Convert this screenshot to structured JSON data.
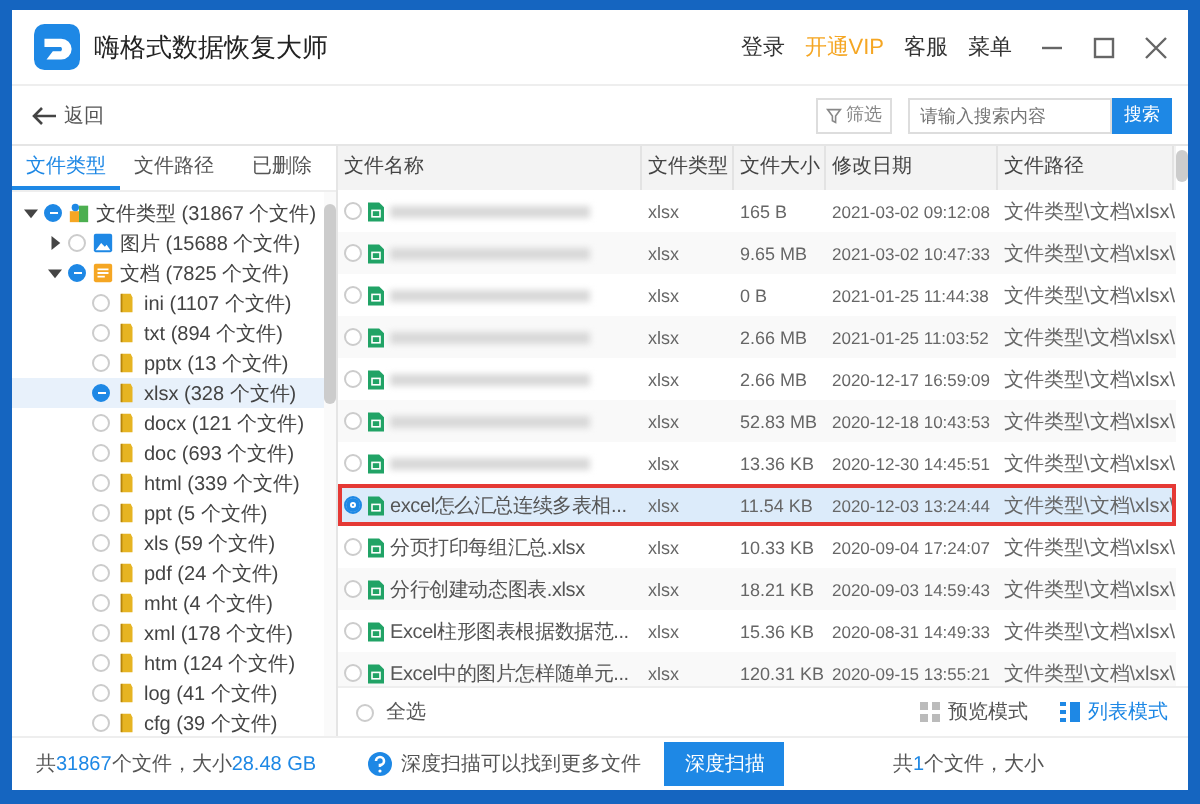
{
  "window": {
    "title": "嗨格式数据恢复大师",
    "actions": [
      {
        "label": "登录",
        "vip": false
      },
      {
        "label": "开通VIP",
        "vip": true
      },
      {
        "label": "客服",
        "vip": false
      },
      {
        "label": "菜单",
        "vip": false
      }
    ]
  },
  "toolbar": {
    "back": "返回",
    "filter": "筛选",
    "search": {
      "placeholder": "请输入搜索内容",
      "button": "搜索"
    }
  },
  "sidebar": {
    "tabs": [
      {
        "label": "文件类型",
        "selected": true
      },
      {
        "label": "文件路径",
        "selected": false
      },
      {
        "label": "已删除",
        "selected": false
      }
    ],
    "tree": [
      {
        "label": "文件类型 (31867 个文件)",
        "partial": true,
        "expanded": true,
        "kind": "root",
        "selected": false,
        "children": [
          {
            "label": "图片 (15688 个文件)",
            "partial": false,
            "expanded": false,
            "kind": "image",
            "selected": false
          },
          {
            "label": "文档 (7825 个文件)",
            "partial": true,
            "expanded": true,
            "kind": "docs",
            "selected": false,
            "children": [
              {
                "label": "ini (1107 个文件)",
                "partial": false,
                "kind": "folder",
                "selected": false
              },
              {
                "label": "txt (894 个文件)",
                "partial": false,
                "kind": "folder",
                "selected": false
              },
              {
                "label": "pptx (13 个文件)",
                "partial": false,
                "kind": "folder",
                "selected": false
              },
              {
                "label": "xlsx (328 个文件)",
                "partial": true,
                "kind": "folder",
                "selected": true
              },
              {
                "label": "docx (121 个文件)",
                "partial": false,
                "kind": "folder",
                "selected": false
              },
              {
                "label": "doc (693 个文件)",
                "partial": false,
                "kind": "folder",
                "selected": false
              },
              {
                "label": "html (339 个文件)",
                "partial": false,
                "kind": "folder",
                "selected": false
              },
              {
                "label": "ppt (5 个文件)",
                "partial": false,
                "kind": "folder",
                "selected": false
              },
              {
                "label": "xls (59 个文件)",
                "partial": false,
                "kind": "folder",
                "selected": false
              },
              {
                "label": "pdf (24 个文件)",
                "partial": false,
                "kind": "folder",
                "selected": false
              },
              {
                "label": "mht (4 个文件)",
                "partial": false,
                "kind": "folder",
                "selected": false
              },
              {
                "label": "xml (178 个文件)",
                "partial": false,
                "kind": "folder",
                "selected": false
              },
              {
                "label": "htm (124 个文件)",
                "partial": false,
                "kind": "folder",
                "selected": false
              },
              {
                "label": "log (41 个文件)",
                "partial": false,
                "kind": "folder",
                "selected": false
              },
              {
                "label": "cfg (39 个文件)",
                "partial": false,
                "kind": "folder",
                "selected": false
              }
            ]
          }
        ]
      }
    ]
  },
  "table": {
    "columns": [
      "文件名称",
      "文件类型",
      "文件大小",
      "修改日期",
      "文件路径"
    ],
    "rows": [
      {
        "name": null,
        "type": "xlsx",
        "size": "165 B",
        "date": "2021-03-02 09:12:08",
        "path": "文件类型\\文档\\xlsx\\",
        "selected": false,
        "marked": false
      },
      {
        "name": null,
        "type": "xlsx",
        "size": "9.65 MB",
        "date": "2021-03-02 10:47:33",
        "path": "文件类型\\文档\\xlsx\\",
        "selected": false,
        "marked": false
      },
      {
        "name": null,
        "type": "xlsx",
        "size": "0 B",
        "date": "2021-01-25 11:44:38",
        "path": "文件类型\\文档\\xlsx\\",
        "selected": false,
        "marked": false
      },
      {
        "name": null,
        "type": "xlsx",
        "size": "2.66 MB",
        "date": "2021-01-25 11:03:52",
        "path": "文件类型\\文档\\xlsx\\",
        "selected": false,
        "marked": false
      },
      {
        "name": null,
        "type": "xlsx",
        "size": "2.66 MB",
        "date": "2020-12-17 16:59:09",
        "path": "文件类型\\文档\\xlsx\\",
        "selected": false,
        "marked": false
      },
      {
        "name": null,
        "type": "xlsx",
        "size": "52.83 MB",
        "date": "2020-12-18 10:43:53",
        "path": "文件类型\\文档\\xlsx\\",
        "selected": false,
        "marked": false
      },
      {
        "name": null,
        "type": "xlsx",
        "size": "13.36 KB",
        "date": "2020-12-30 14:45:51",
        "path": "文件类型\\文档\\xlsx\\",
        "selected": false,
        "marked": false
      },
      {
        "name": "excel怎么汇总连续多表相...",
        "type": "xlsx",
        "size": "11.54 KB",
        "date": "2020-12-03 13:24:44",
        "path": "文件类型\\文档\\xlsx\\",
        "selected": true,
        "marked": true
      },
      {
        "name": "分页打印每组汇总.xlsx",
        "type": "xlsx",
        "size": "10.33 KB",
        "date": "2020-09-04 17:24:07",
        "path": "文件类型\\文档\\xlsx\\",
        "selected": false,
        "marked": false
      },
      {
        "name": "分行创建动态图表.xlsx",
        "type": "xlsx",
        "size": "18.21 KB",
        "date": "2020-09-03 14:59:43",
        "path": "文件类型\\文档\\xlsx\\",
        "selected": false,
        "marked": false
      },
      {
        "name": "Excel柱形图表根据数据范...",
        "type": "xlsx",
        "size": "15.36 KB",
        "date": "2020-08-31 14:49:33",
        "path": "文件类型\\文档\\xlsx\\",
        "selected": false,
        "marked": false
      },
      {
        "name": "Excel中的图片怎样随单元...",
        "type": "xlsx",
        "size": "120.31 KB",
        "date": "2020-09-15 13:55:21",
        "path": "文件类型\\文档\\xlsx\\",
        "selected": false,
        "marked": false
      }
    ]
  },
  "list_footer": {
    "select_all": {
      "label": "全选",
      "checked": false
    },
    "views": [
      {
        "label": "预览模式",
        "kind": "grid",
        "selected": false
      },
      {
        "label": "列表模式",
        "kind": "list",
        "selected": true
      }
    ]
  },
  "status_bar": {
    "left": [
      {
        "text": "共",
        "highlight": false
      },
      {
        "text": "31867",
        "highlight": true
      },
      {
        "text": "个文件，大小",
        "highlight": false
      },
      {
        "text": "28.48 GB",
        "highlight": true
      }
    ],
    "hint": "深度扫描可以找到更多文件",
    "deep_scan": "深度扫描",
    "right": [
      {
        "text": "共",
        "highlight": false
      },
      {
        "text": "1",
        "highlight": true
      },
      {
        "text": "个文件，大小",
        "highlight": false
      }
    ]
  }
}
